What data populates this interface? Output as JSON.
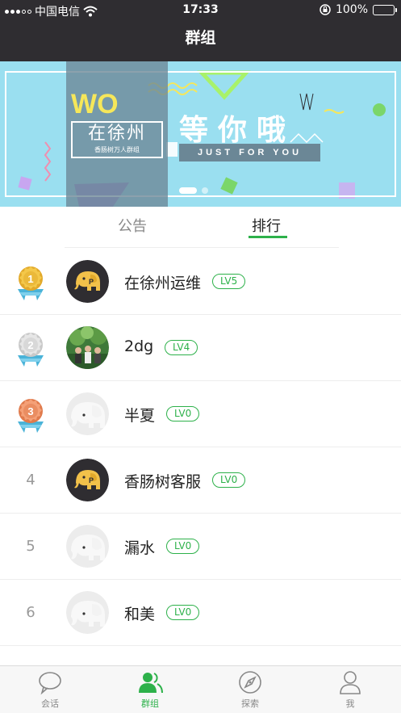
{
  "status": {
    "carrier": "中国电信",
    "time": "17:33",
    "battery": "100%",
    "battery_level": 1.0,
    "wifi_icon": "wifi-icon",
    "lock_icon": "orientation-lock-icon"
  },
  "nav": {
    "title": "群组"
  },
  "banner": {
    "headline": "WO",
    "city": "在徐州",
    "city_sub": "香肠树万人群组",
    "slogan": "等你哦",
    "tagline": "JUST FOR YOU"
  },
  "tabs": [
    {
      "label": "公告",
      "active": false
    },
    {
      "label": "排行",
      "active": true
    }
  ],
  "ranking": [
    {
      "rank": "1",
      "medal": "gold",
      "name": "在徐州运维",
      "level": "LV5",
      "avatar": "elephant-dark"
    },
    {
      "rank": "2",
      "medal": "silver",
      "name": "2dg",
      "level": "LV4",
      "avatar": "photo-green"
    },
    {
      "rank": "3",
      "medal": "bronze",
      "name": "半夏",
      "level": "LV0",
      "avatar": "elephant-light"
    },
    {
      "rank": "4",
      "medal": "",
      "name": "香肠树客服",
      "level": "LV0",
      "avatar": "elephant-dark"
    },
    {
      "rank": "5",
      "medal": "",
      "name": "漏水",
      "level": "LV0",
      "avatar": "elephant-light"
    },
    {
      "rank": "6",
      "medal": "",
      "name": "和美",
      "level": "LV0",
      "avatar": "elephant-light"
    }
  ],
  "tabbar": [
    {
      "label": "会话",
      "icon": "chat-bubble-icon",
      "active": false
    },
    {
      "label": "群组",
      "icon": "group-icon",
      "active": true
    },
    {
      "label": "探索",
      "icon": "compass-icon",
      "active": false
    },
    {
      "label": "我",
      "icon": "person-icon",
      "active": false
    }
  ],
  "colors": {
    "accent": "#2db14a",
    "nav_bg": "#2f2d31",
    "banner_bg": "#9adff0"
  }
}
